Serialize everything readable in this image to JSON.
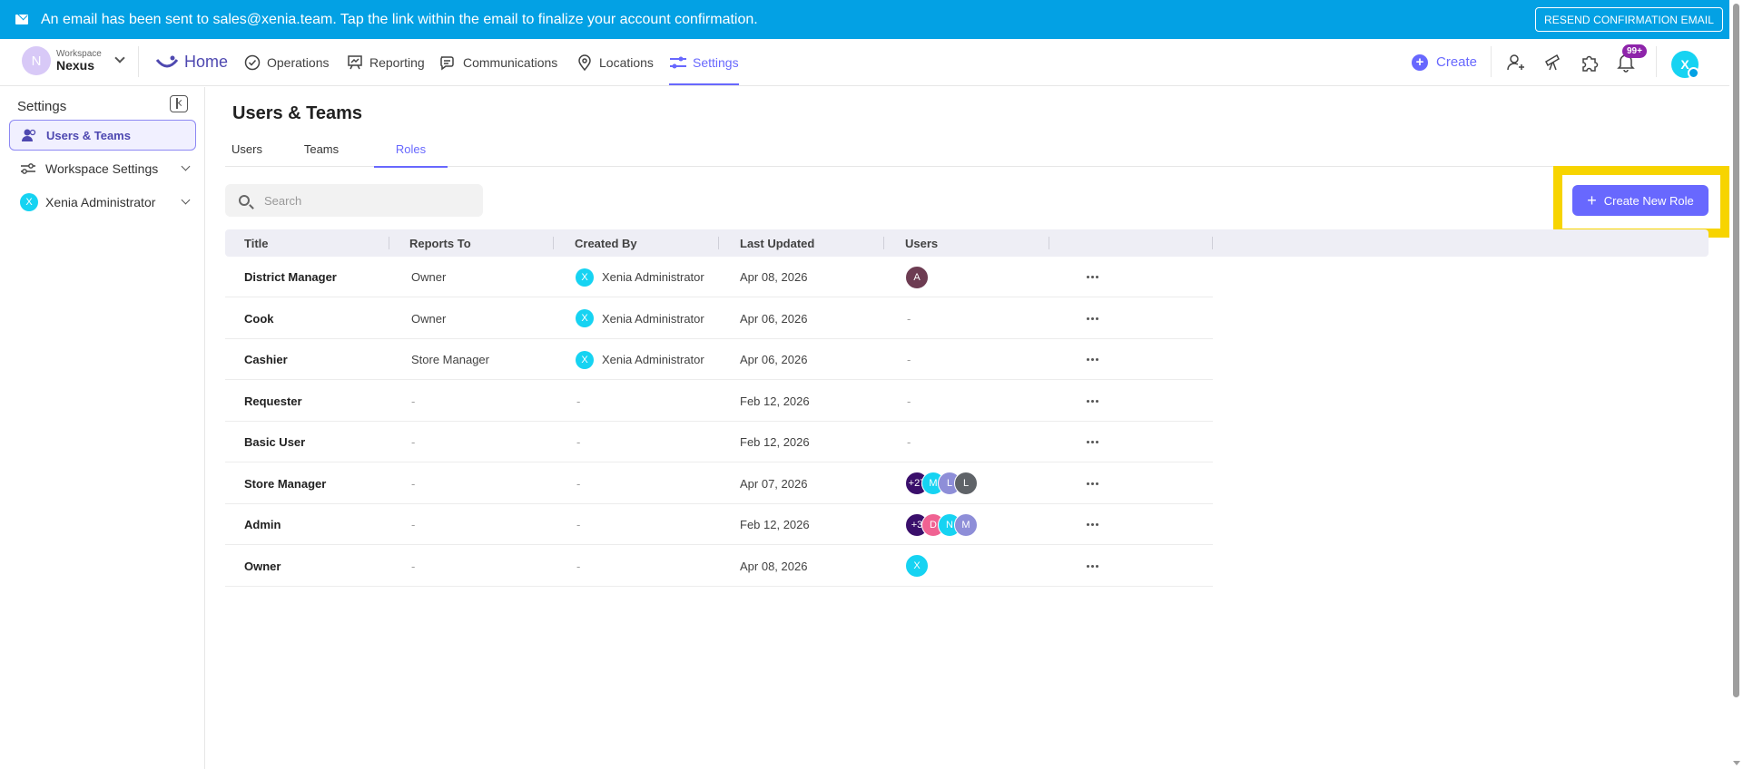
{
  "banner": {
    "message": "An email has been sent to sales@xenia.team. Tap the link within the email to finalize your account confirmation.",
    "resend_label": "RESEND CONFIRMATION EMAIL"
  },
  "workspace": {
    "initial": "N",
    "label": "Workspace",
    "name": "Nexus"
  },
  "nav": {
    "home": "Home",
    "operations": "Operations",
    "reporting": "Reporting",
    "communications": "Communications",
    "locations": "Locations",
    "settings": "Settings",
    "create": "Create",
    "notification_badge": "99+",
    "user_initial": "X"
  },
  "sidebar": {
    "title": "Settings",
    "items": [
      {
        "label": "Users & Teams"
      },
      {
        "label": "Workspace Settings"
      },
      {
        "label": "Xenia Administrator",
        "initial": "X"
      }
    ]
  },
  "main": {
    "title": "Users & Teams",
    "tabs": [
      "Users",
      "Teams",
      "Roles"
    ],
    "active_tab": "Roles",
    "search_placeholder": "Search",
    "create_role_label": "Create New Role",
    "columns": [
      "Title",
      "Reports To",
      "Created By",
      "Last Updated",
      "Users"
    ],
    "rows": [
      {
        "title": "District Manager",
        "reports_to": "Owner",
        "created_by": "Xenia Administrator",
        "creator_initial": "X",
        "last_updated": "Apr 08, 2026",
        "users_dash": "",
        "avatars": [
          {
            "t": "A",
            "c": "#6d3c52"
          }
        ]
      },
      {
        "title": "Cook",
        "reports_to": "Owner",
        "created_by": "Xenia Administrator",
        "creator_initial": "X",
        "last_updated": "Apr 06, 2026",
        "users_dash": "-",
        "avatars": []
      },
      {
        "title": "Cashier",
        "reports_to": "Store Manager",
        "created_by": "Xenia Administrator",
        "creator_initial": "X",
        "last_updated": "Apr 06, 2026",
        "users_dash": "-",
        "avatars": []
      },
      {
        "title": "Requester",
        "reports_to": "-",
        "created_by": "-",
        "creator_initial": "",
        "last_updated": "Feb 12, 2026",
        "users_dash": "-",
        "avatars": []
      },
      {
        "title": "Basic User",
        "reports_to": "-",
        "created_by": "-",
        "creator_initial": "",
        "last_updated": "Feb 12, 2026",
        "users_dash": "-",
        "avatars": []
      },
      {
        "title": "Store Manager",
        "reports_to": "-",
        "created_by": "-",
        "creator_initial": "",
        "last_updated": "Apr 07, 2026",
        "users_dash": "",
        "avatars": [
          {
            "t": "+27",
            "c": "#3a0f6b"
          },
          {
            "t": "M",
            "c": "#16d3f2"
          },
          {
            "t": "L",
            "c": "#8e8ed8"
          },
          {
            "t": "L",
            "c": "#5f6368"
          }
        ]
      },
      {
        "title": "Admin",
        "reports_to": "-",
        "created_by": "-",
        "creator_initial": "",
        "last_updated": "Feb 12, 2026",
        "users_dash": "",
        "avatars": [
          {
            "t": "+3",
            "c": "#3a0f6b"
          },
          {
            "t": "D",
            "c": "#f06292"
          },
          {
            "t": "N",
            "c": "#16d3f2"
          },
          {
            "t": "M",
            "c": "#8e8ed8"
          }
        ]
      },
      {
        "title": "Owner",
        "reports_to": "-",
        "created_by": "-",
        "creator_initial": "",
        "last_updated": "Apr 08, 2026",
        "users_dash": "",
        "avatars": [
          {
            "t": "X",
            "c": "#16d3f2"
          }
        ]
      }
    ]
  }
}
